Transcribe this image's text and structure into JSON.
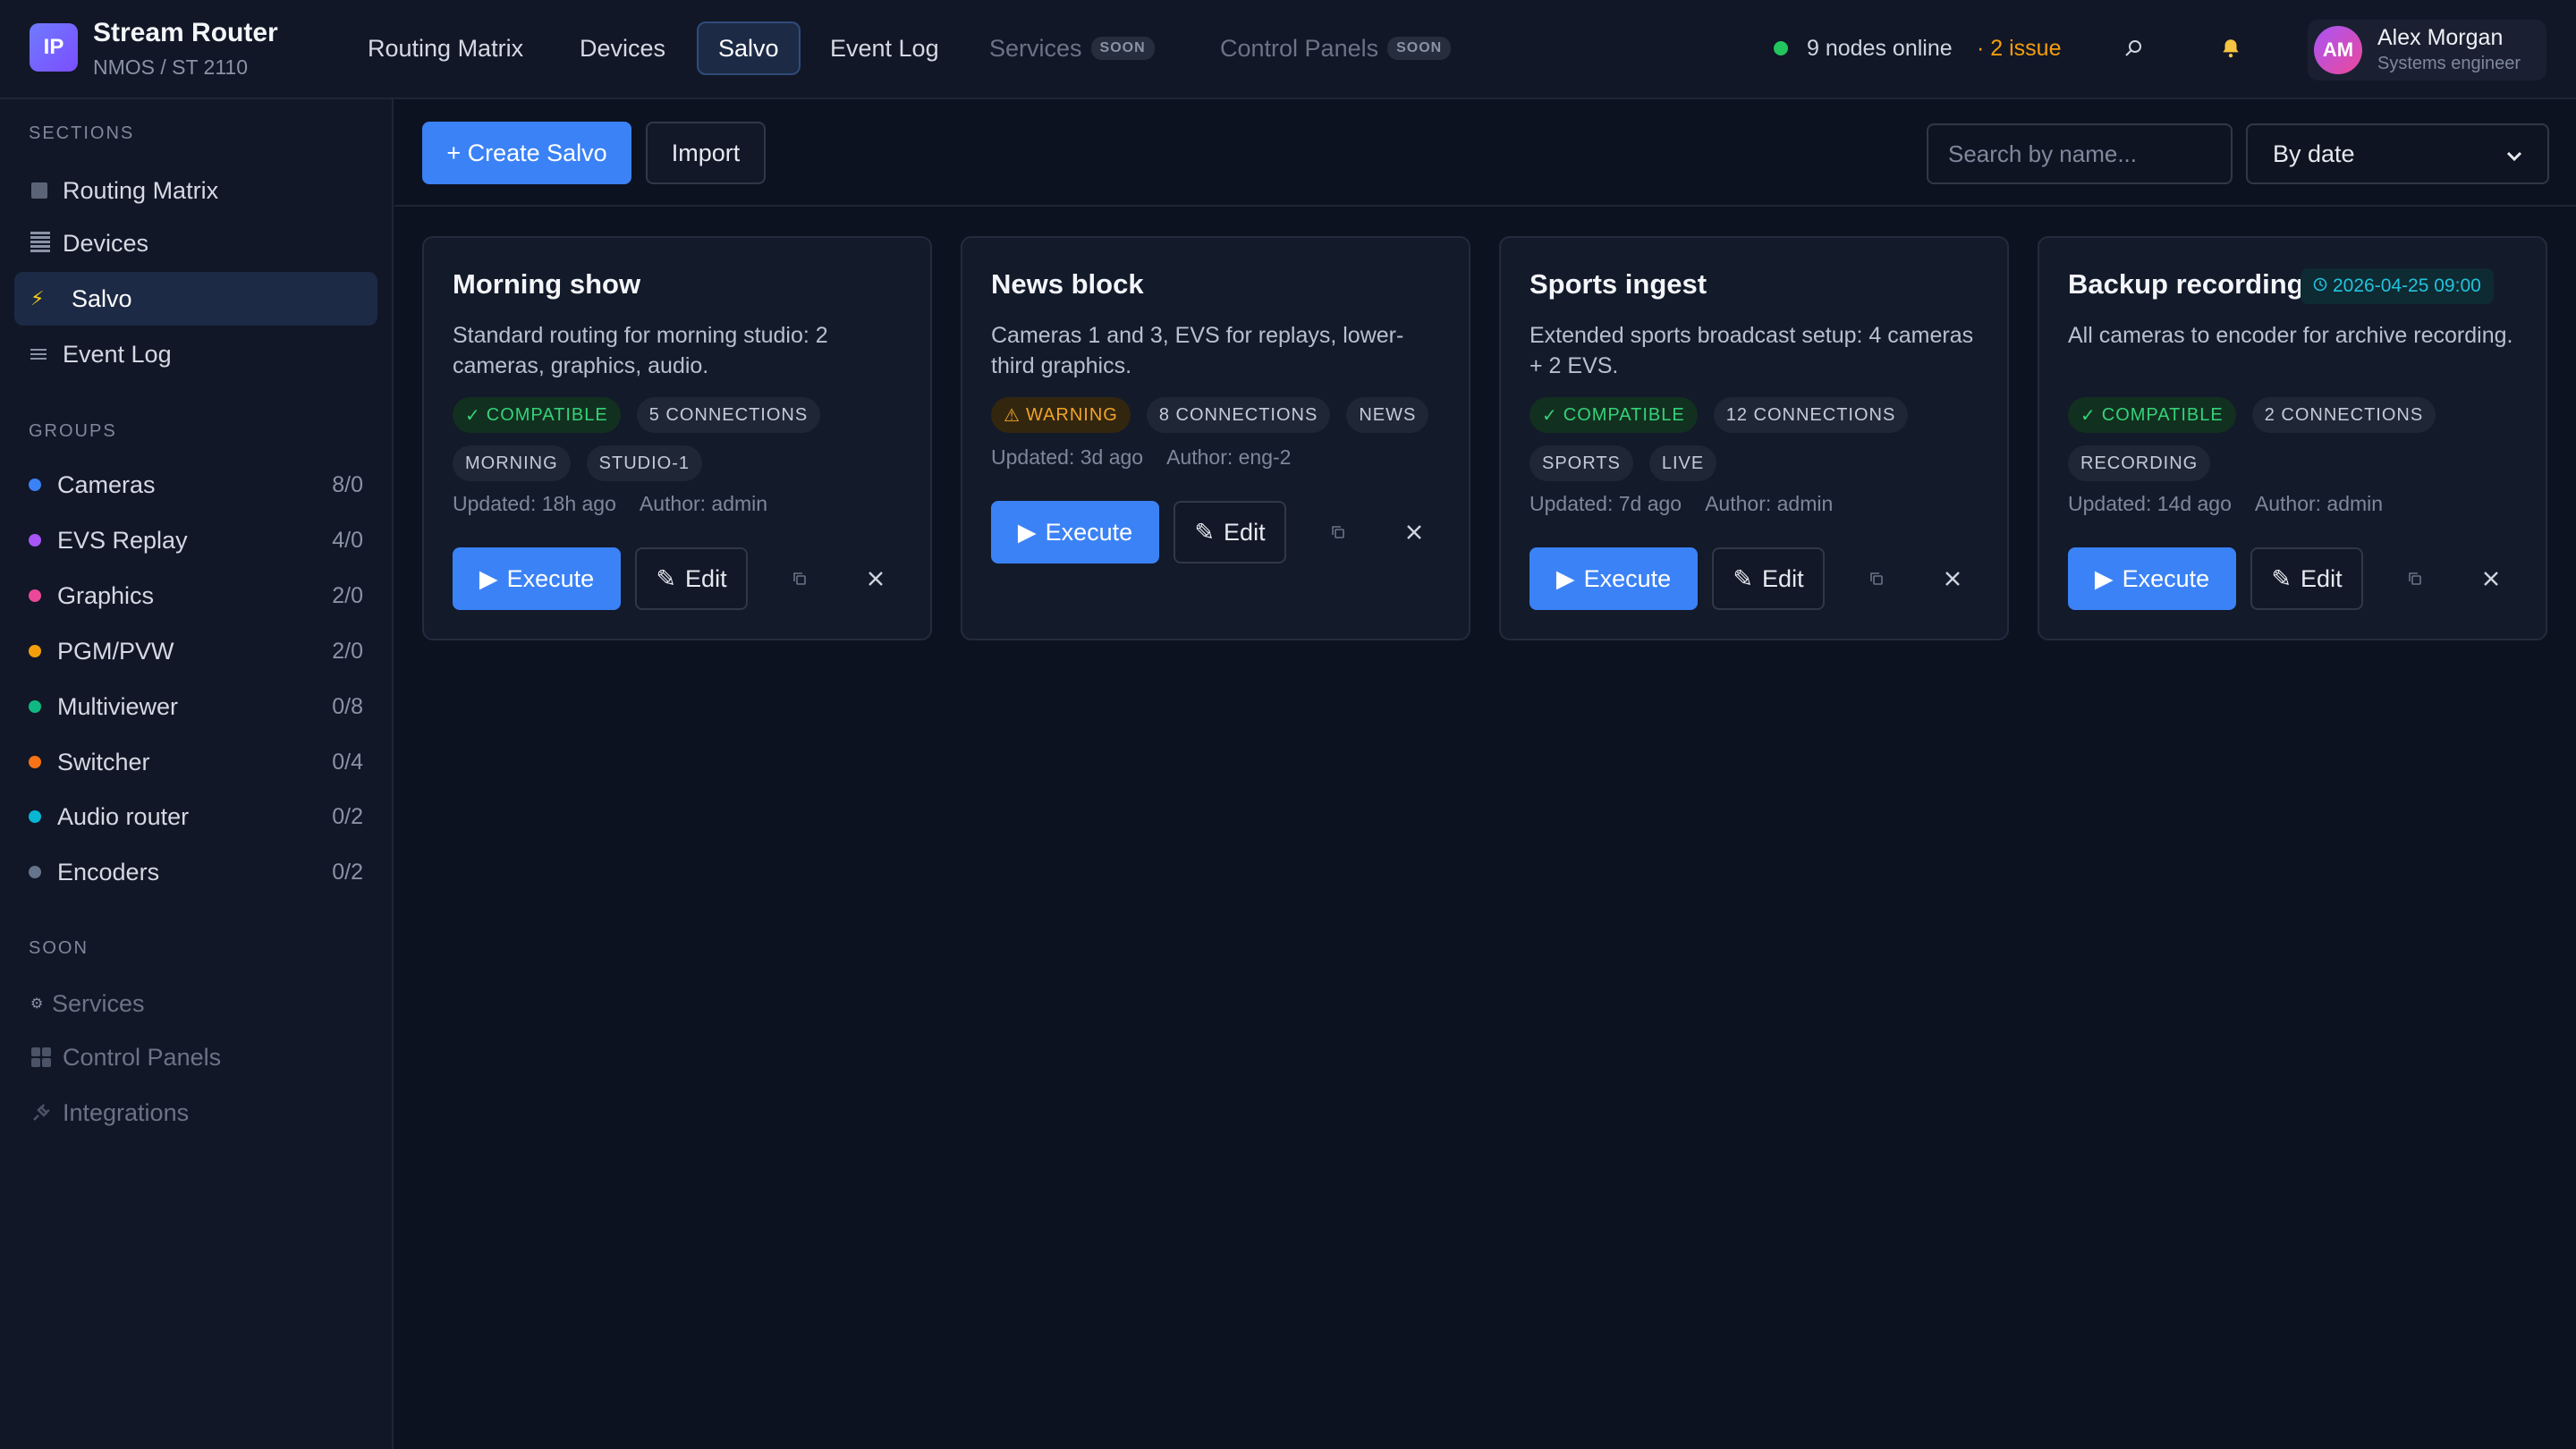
{
  "app": {
    "logo_text": "IP",
    "title": "Stream Router",
    "subtitle": "NMOS / ST 2110"
  },
  "nav": {
    "items": [
      {
        "label": "Routing Matrix"
      },
      {
        "label": "Devices"
      },
      {
        "label": "Salvo",
        "active": true
      },
      {
        "label": "Event Log"
      },
      {
        "label": "Services",
        "badge": "SOON",
        "disabled": true
      },
      {
        "label": "Control Panels",
        "badge": "SOON",
        "disabled": true
      }
    ]
  },
  "status": {
    "nodes_online": "9 nodes online",
    "issues": "· 2 issue",
    "ok_color": "#22c55e",
    "warn_color": "#f59e0b"
  },
  "user": {
    "initials": "AM",
    "name": "Alex Morgan",
    "role": "Systems engineer"
  },
  "sidebar": {
    "sections_heading": "SECTIONS",
    "sections": [
      {
        "label": "Routing Matrix",
        "icon": "grid-icon"
      },
      {
        "label": "Devices",
        "icon": "list-icon"
      },
      {
        "label": "Salvo",
        "icon": "lightning-icon",
        "active": true
      },
      {
        "label": "Event Log",
        "icon": "lines-icon"
      }
    ],
    "groups_heading": "GROUPS",
    "groups": [
      {
        "label": "Cameras",
        "count": "8/0",
        "color": "#3b82f6"
      },
      {
        "label": "EVS Replay",
        "count": "4/0",
        "color": "#a855f7"
      },
      {
        "label": "Graphics",
        "count": "2/0",
        "color": "#ec4899"
      },
      {
        "label": "PGM/PVW",
        "count": "2/0",
        "color": "#f59e0b"
      },
      {
        "label": "Multiviewer",
        "count": "0/8",
        "color": "#10b981"
      },
      {
        "label": "Switcher",
        "count": "0/4",
        "color": "#f97316"
      },
      {
        "label": "Audio router",
        "count": "0/2",
        "color": "#06b6d4"
      },
      {
        "label": "Encoders",
        "count": "0/2",
        "color": "#64748b"
      }
    ],
    "soon_heading": "SOON",
    "soon": [
      {
        "label": "Services",
        "icon": "gear-icon"
      },
      {
        "label": "Control Panels",
        "icon": "panel-icon"
      },
      {
        "label": "Integrations",
        "icon": "plug-icon"
      }
    ]
  },
  "toolbar": {
    "create_label": "+ Create Salvo",
    "import_label": "Import",
    "search_placeholder": "Search by name...",
    "sort_value": "By date"
  },
  "salvos": [
    {
      "title": "Morning show",
      "description": "Standard routing for morning studio: 2 cameras, graphics, audio.",
      "status": "COMPATIBLE",
      "status_type": "ok",
      "connections": "5 CONNECTIONS",
      "tags": [
        "MORNING",
        "STUDIO-1"
      ],
      "updated": "Updated: 18h ago",
      "author": "Author: admin",
      "execute_label": "Execute",
      "edit_label": "Edit"
    },
    {
      "title": "News block",
      "description": "Cameras 1 and 3, EVS for replays, lower-third graphics.",
      "status": "WARNING",
      "status_type": "warn",
      "connections": "8 CONNECTIONS",
      "tags": [
        "NEWS"
      ],
      "updated": "Updated: 3d ago",
      "author": "Author: eng-2",
      "execute_label": "Execute",
      "edit_label": "Edit"
    },
    {
      "title": "Sports ingest",
      "description": "Extended sports broadcast setup: 4 cameras + 2 EVS.",
      "status": "COMPATIBLE",
      "status_type": "ok",
      "connections": "12 CONNECTIONS",
      "tags": [
        "SPORTS",
        "LIVE"
      ],
      "updated": "Updated: 7d ago",
      "author": "Author: admin",
      "execute_label": "Execute",
      "edit_label": "Edit"
    },
    {
      "title": "Backup recording",
      "schedule": "2026-04-25 09:00",
      "description": "All cameras to encoder for archive recording.",
      "status": "COMPATIBLE",
      "status_type": "ok",
      "connections": "2 CONNECTIONS",
      "tags": [
        "RECORDING"
      ],
      "updated": "Updated: 14d ago",
      "author": "Author: admin",
      "execute_label": "Execute",
      "edit_label": "Edit"
    }
  ]
}
